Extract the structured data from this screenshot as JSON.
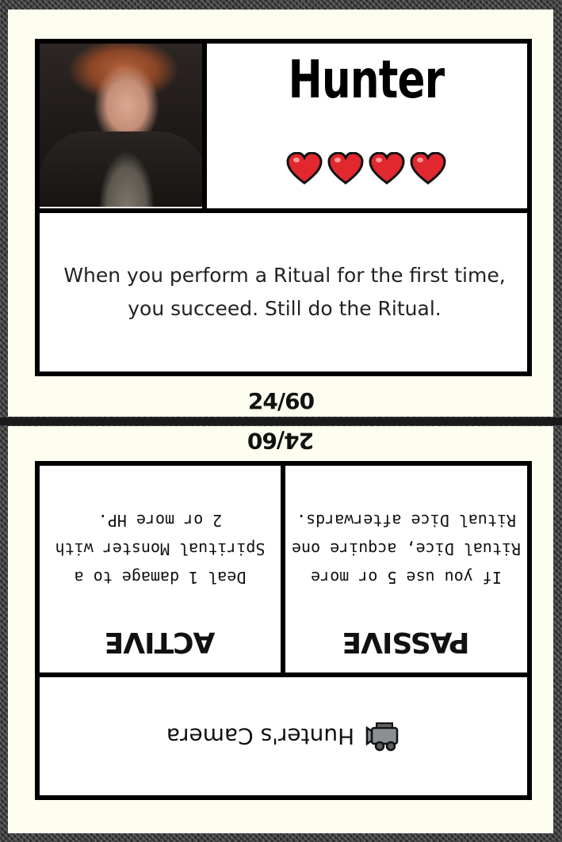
{
  "card": {
    "name": "Hunter",
    "hearts": 4,
    "heart_color": "#e0282e",
    "ability": "When you perform a Ritual for the first time, you succeed. Still do the Ritual.",
    "counter_top": "24/60",
    "counter_bottom": "24/60"
  },
  "skills": {
    "passive": {
      "heading": "PASSIVE",
      "lines": [
        "If you use 5 or more",
        "Ritual Dice, acquire one",
        "Ritual Dice afterwards."
      ]
    },
    "active": {
      "heading": "ACTIVE",
      "lines": [
        "Deal 1 damage to a",
        "Spiritual Monster with",
        "2 or more HP."
      ]
    }
  },
  "item": {
    "name": "Hunter's Camera",
    "icon": "camera-icon"
  }
}
